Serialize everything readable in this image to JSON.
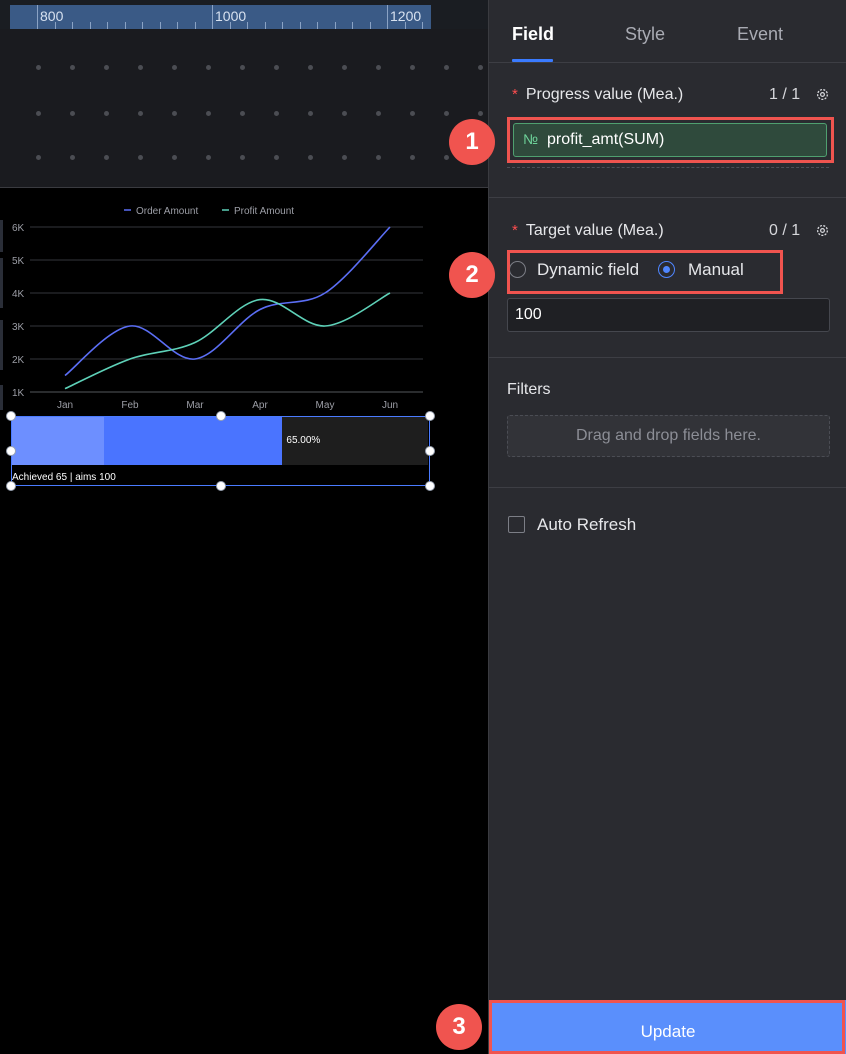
{
  "ruler": {
    "ticks": [
      "800",
      "1000",
      "1200"
    ]
  },
  "chart_data": {
    "type": "line",
    "categories": [
      "Jan",
      "Feb",
      "Mar",
      "Apr",
      "May",
      "Jun"
    ],
    "series": [
      {
        "name": "Order Amount",
        "values": [
          1500,
          3000,
          2000,
          3500,
          4000,
          6000
        ],
        "color": "#5b6ef5"
      },
      {
        "name": "Profit Amount",
        "values": [
          1100,
          2000,
          2500,
          3800,
          3000,
          4000
        ],
        "color": "#5ed1b8"
      }
    ],
    "y_ticks": [
      "1K",
      "2K",
      "3K",
      "4K",
      "5K",
      "6K"
    ],
    "ylim": [
      1000,
      6000
    ],
    "legend": "top",
    "grid": true
  },
  "progress": {
    "value": 0.65,
    "light_fraction": 0.22,
    "percent_label": "65.00%",
    "caption": "Achieved 65 | aims 100",
    "color": "#4a74ff"
  },
  "panel": {
    "tabs": [
      "Field",
      "Style",
      "Event"
    ],
    "active_tab": "Field",
    "progress_value": {
      "title": "Progress value (Mea.)",
      "count": "1 / 1",
      "field_prefix": "№",
      "field_name": "profit_amt(SUM)"
    },
    "target_value": {
      "title": "Target value (Mea.)",
      "count": "0 / 1",
      "options": [
        "Dynamic field",
        "Manual"
      ],
      "selected": "Manual",
      "input_value": "100"
    },
    "filters": {
      "title": "Filters",
      "placeholder": "Drag and drop fields here."
    },
    "auto_refresh_label": "Auto Refresh",
    "update_label": "Update"
  },
  "annotations": [
    "1",
    "2",
    "3"
  ],
  "colors": {
    "accent": "#3a7bff",
    "annotation": "#f0544f",
    "required": "#ff4d4f"
  }
}
